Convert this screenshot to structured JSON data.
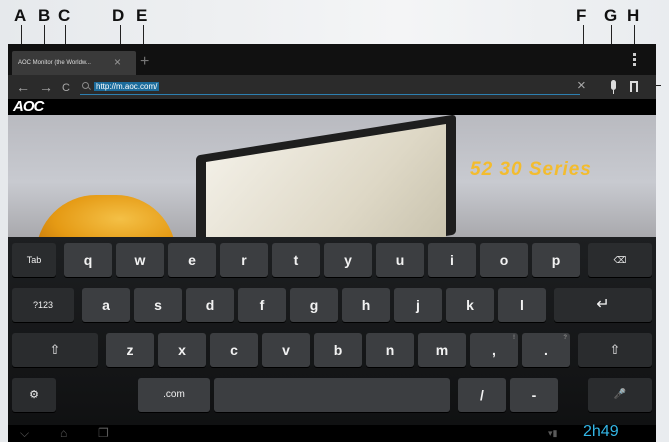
{
  "callouts": {
    "a": "A",
    "b": "B",
    "c": "C",
    "d": "D",
    "e": "E",
    "f": "F",
    "g": "G",
    "h": "H"
  },
  "browser": {
    "tab_title": "AOC Monitor (the Worldw...",
    "tab_close": "×",
    "new_tab": "+",
    "back": "←",
    "forward": "→",
    "reload": "C",
    "url": "http://m.aoc.com/",
    "clear": "×"
  },
  "page": {
    "logo": "AOC",
    "series": "52 30 Series"
  },
  "keyboard": {
    "row1": [
      "Tab",
      "q",
      "w",
      "e",
      "r",
      "t",
      "y",
      "u",
      "i",
      "o",
      "p",
      "⌫"
    ],
    "row2": [
      "?123",
      "a",
      "s",
      "d",
      "f",
      "g",
      "h",
      "j",
      "k",
      "l",
      "↵"
    ],
    "row3": [
      "⇧",
      "z",
      "x",
      "c",
      "v",
      "b",
      "n",
      "m",
      ",",
      ".",
      "⇧"
    ],
    "row3_hints": [
      "!",
      "?"
    ],
    "row4": [
      "⚙",
      ".com",
      "",
      "/",
      "-",
      "🎤"
    ]
  },
  "system": {
    "back": "⌵",
    "home": "⌂",
    "recents": "❐",
    "clock": "2h49",
    "status_icons": "▾▮"
  },
  "colors": {
    "accent": "#33b5e5",
    "key": "#3c3e41",
    "series_text": "#f3bc2e"
  }
}
